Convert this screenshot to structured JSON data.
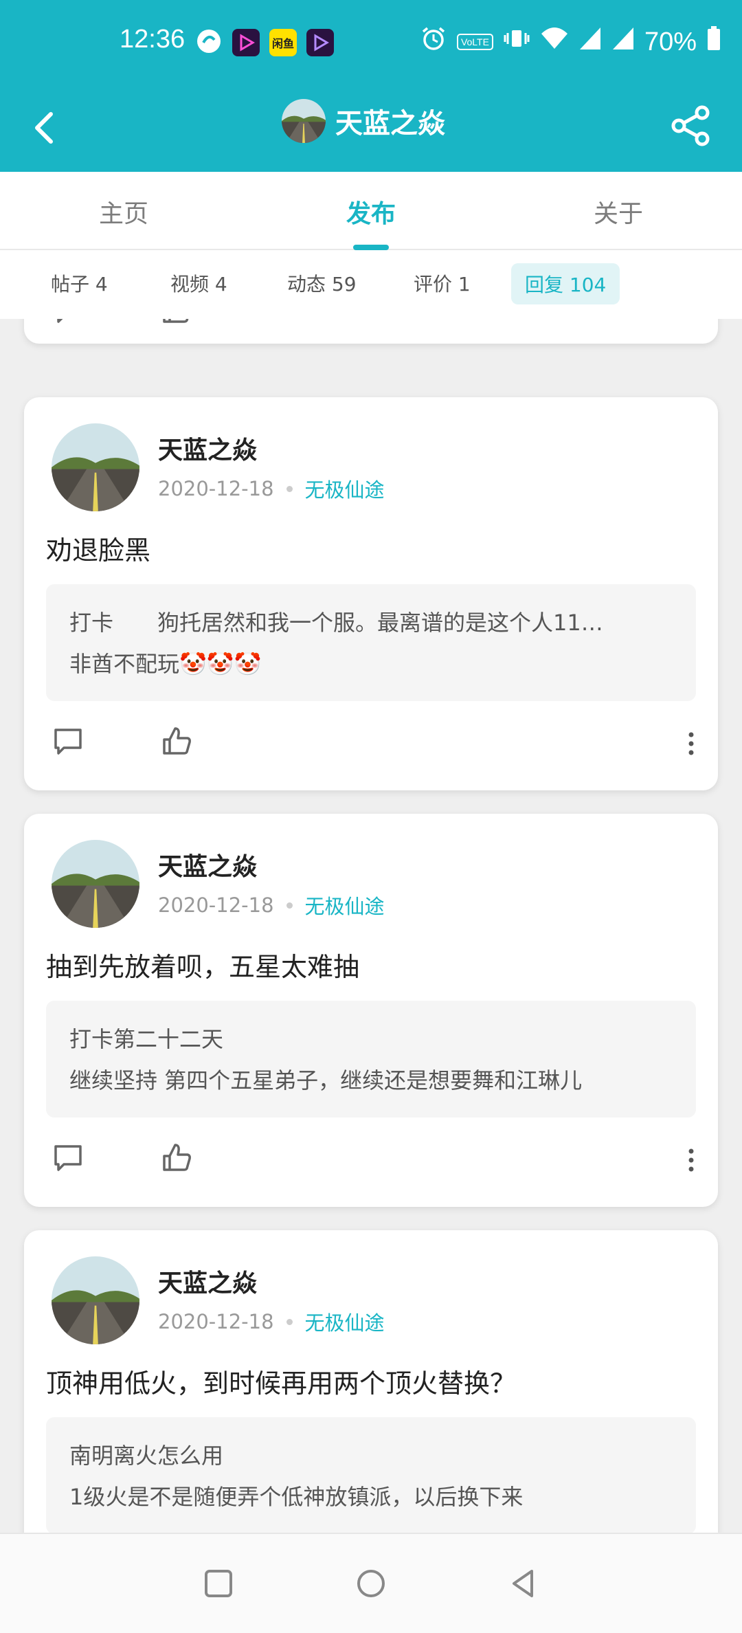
{
  "status_bar": {
    "time": "12:36",
    "battery": "70%",
    "app_badge_text": "闲鱼",
    "lte_label": "VoLTE"
  },
  "header": {
    "title": "天蓝之焱",
    "colors": {
      "accent": "#19b5c5"
    }
  },
  "tabs": [
    {
      "label": "主页"
    },
    {
      "label": "发布"
    },
    {
      "label": "关于"
    }
  ],
  "subtabs": [
    {
      "label": "帖子 4"
    },
    {
      "label": "视频 4"
    },
    {
      "label": "动态 59"
    },
    {
      "label": "评价 1"
    },
    {
      "label": "回复 104"
    }
  ],
  "cards": [
    {
      "author": "天蓝之焱",
      "date": "2020-12-18",
      "game": "无极仙途",
      "reply": "劝退脸黑",
      "quote_lines": [
        "打卡　　狗托居然和我一个服。最离谱的是这个人11…",
        "非酋不配玩🤡🤡🤡"
      ]
    },
    {
      "author": "天蓝之焱",
      "date": "2020-12-18",
      "game": "无极仙途",
      "reply": "抽到先放着呗，五星太难抽",
      "quote_lines": [
        "打卡第二十二天",
        "继续坚持 第四个五星弟子，继续还是想要舞和江琳儿"
      ]
    },
    {
      "author": "天蓝之焱",
      "date": "2020-12-18",
      "game": "无极仙途",
      "reply": "顶神用低火，到时候再用两个顶火替换？",
      "quote_lines": [
        "南明离火怎么用",
        "1级火是不是随便弄个低神放镇派，以后换下来"
      ]
    }
  ]
}
